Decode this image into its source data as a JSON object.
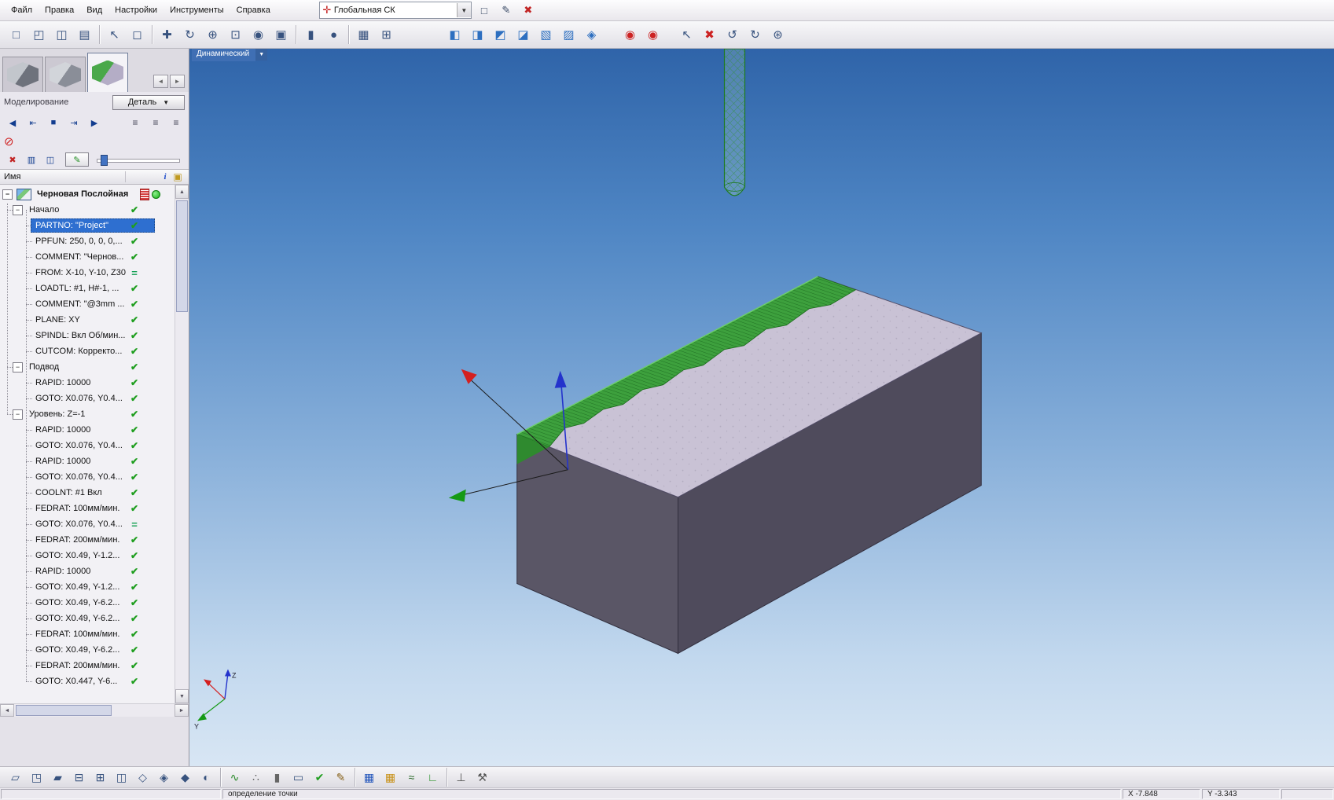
{
  "menubar": {
    "items": [
      "Файл",
      "Правка",
      "Вид",
      "Настройки",
      "Инструменты",
      "Справка"
    ],
    "csys_combo": {
      "value": "Глобальная СК",
      "icon": "✛"
    },
    "buttons": [
      {
        "name": "new-page",
        "glyph": "□"
      },
      {
        "name": "edit-postprocessor",
        "glyph": "✎"
      },
      {
        "name": "close-red",
        "glyph": "✖",
        "color": "#c22525"
      }
    ]
  },
  "toolbar_top": [
    {
      "name": "new-file",
      "glyph": "□"
    },
    {
      "name": "open-folder",
      "glyph": "◰"
    },
    {
      "name": "save-file",
      "glyph": "◫"
    },
    {
      "name": "print",
      "glyph": "▤"
    },
    {
      "sep": true
    },
    {
      "name": "select-arrow",
      "glyph": "↖"
    },
    {
      "name": "select-region",
      "glyph": "◻"
    },
    {
      "sep": true
    },
    {
      "name": "pan-view",
      "glyph": "✚"
    },
    {
      "name": "rotate-view",
      "glyph": "↻"
    },
    {
      "name": "zoom-view",
      "glyph": "⊕"
    },
    {
      "name": "zoom-window",
      "glyph": "⊡"
    },
    {
      "name": "camera-view",
      "glyph": "◉"
    },
    {
      "name": "snapshot",
      "glyph": "▣"
    },
    {
      "sep": true
    },
    {
      "name": "stock-cylinder",
      "glyph": "▮"
    },
    {
      "name": "stock-sphere",
      "glyph": "●"
    },
    {
      "sep": true
    },
    {
      "name": "data-table",
      "glyph": "▦"
    },
    {
      "name": "calculator",
      "glyph": "⊞"
    },
    {
      "space": 58
    },
    {
      "name": "view-filter-1",
      "glyph": "◧",
      "color": "#2d6fc0"
    },
    {
      "name": "view-filter-2",
      "glyph": "◨",
      "color": "#2d6fc0"
    },
    {
      "name": "view-filter-3",
      "glyph": "◩",
      "color": "#2d6fc0"
    },
    {
      "name": "view-filter-4",
      "glyph": "◪",
      "color": "#2d6fc0"
    },
    {
      "name": "view-filter-5",
      "glyph": "▧",
      "color": "#2d6fc0"
    },
    {
      "name": "view-filter-6",
      "glyph": "▨",
      "color": "#2d6fc0"
    },
    {
      "name": "view-filter-7",
      "glyph": "◈",
      "color": "#2d6fc0"
    },
    {
      "space": 20
    },
    {
      "name": "probe-point-1",
      "glyph": "◉",
      "color": "#cc2222"
    },
    {
      "name": "probe-point-2",
      "glyph": "◉",
      "color": "#cc2222"
    },
    {
      "space": 14
    },
    {
      "name": "cursor-erase",
      "glyph": "↖"
    },
    {
      "name": "delete-item",
      "glyph": "✖",
      "color": "#cc2222"
    },
    {
      "name": "rotate-ccw",
      "glyph": "↺"
    },
    {
      "name": "rotate-cw",
      "glyph": "↻"
    },
    {
      "name": "transform",
      "glyph": "⊛"
    }
  ],
  "left_panel": {
    "tabs": [
      {
        "name": "thumbnail-tab-1",
        "colors": [
          "#c2c6cc",
          "#6e727c"
        ]
      },
      {
        "name": "thumbnail-tab-2",
        "colors": [
          "#d2d5da",
          "#8a8e98"
        ]
      },
      {
        "name": "thumbnail-tab-3",
        "colors": [
          "#4aa84a",
          "#b4adc6"
        ]
      }
    ],
    "active_tab": 2,
    "tab_nav": [
      {
        "name": "tabs-scroll-left",
        "glyph": "◄"
      },
      {
        "name": "tabs-scroll-right",
        "glyph": "►"
      }
    ],
    "mode_label": "Моделирование",
    "detail_button": "Деталь",
    "playback": [
      {
        "name": "sim-step-back",
        "glyph": "◀"
      },
      {
        "name": "sim-to-begin",
        "glyph": "⇤"
      },
      {
        "name": "sim-stop",
        "glyph": "■"
      },
      {
        "name": "sim-to-end",
        "glyph": "⇥"
      },
      {
        "name": "sim-play",
        "glyph": "▶"
      }
    ],
    "trace_buttons": [
      {
        "name": "trace-list-1",
        "glyph": "≡"
      },
      {
        "name": "trace-list-2",
        "glyph": "≡"
      },
      {
        "name": "trace-list-3",
        "glyph": "≡"
      }
    ],
    "interrupt_glyph": "⊘",
    "edit_row": [
      {
        "name": "delete-trace",
        "glyph": "✖",
        "color": "#c22525"
      },
      {
        "name": "copy-trace",
        "glyph": "▥"
      },
      {
        "name": "save-trace",
        "glyph": "◫"
      }
    ],
    "pencil_glyph": "✎",
    "tree_header": {
      "name": "Имя",
      "info_glyph": "i",
      "folder_glyph": "▣"
    },
    "expander_glyph": "−",
    "check_glyph": "✔",
    "eq_glyph": "=",
    "tree": [
      {
        "label": "Черновая Послойная",
        "kind": "root",
        "status": "none",
        "extras": [
          "red-badge",
          "green-dot"
        ]
      },
      {
        "label": "Начало",
        "kind": "group",
        "status": "check"
      },
      {
        "label": "PARTNO: \"Project\"",
        "kind": "leaf",
        "status": "check",
        "selected": true
      },
      {
        "label": "PPFUN: 250, 0, 0, 0,...",
        "kind": "leaf",
        "status": "check"
      },
      {
        "label": "COMMENT: \"Чернов...",
        "kind": "leaf",
        "status": "check"
      },
      {
        "label": "FROM: X-10, Y-10, Z30",
        "kind": "leaf",
        "status": "eq"
      },
      {
        "label": "LOADTL: #1, H#-1, ...",
        "kind": "leaf",
        "status": "check"
      },
      {
        "label": "COMMENT: \"@3mm ...",
        "kind": "leaf",
        "status": "check"
      },
      {
        "label": "PLANE: XY",
        "kind": "leaf",
        "status": "check"
      },
      {
        "label": "SPINDL: Вкл Об/мин...",
        "kind": "leaf",
        "status": "check"
      },
      {
        "label": "CUTCOM: Корректо...",
        "kind": "leaf",
        "status": "check"
      },
      {
        "label": "Подвод",
        "kind": "group",
        "status": "check"
      },
      {
        "label": "RAPID: 10000",
        "kind": "leaf",
        "status": "check"
      },
      {
        "label": "GOTO: X0.076, Y0.4...",
        "kind": "leaf",
        "status": "check"
      },
      {
        "label": "Уровень: Z=-1",
        "kind": "group",
        "status": "check"
      },
      {
        "label": "RAPID: 10000",
        "kind": "leaf",
        "status": "check"
      },
      {
        "label": "GOTO: X0.076, Y0.4...",
        "kind": "leaf",
        "status": "check"
      },
      {
        "label": "RAPID: 10000",
        "kind": "leaf",
        "status": "check"
      },
      {
        "label": "GOTO: X0.076, Y0.4...",
        "kind": "leaf",
        "status": "check"
      },
      {
        "label": "COOLNT: #1 Вкл",
        "kind": "leaf",
        "status": "check"
      },
      {
        "label": "FEDRAT: 100мм/мин.",
        "kind": "leaf",
        "status": "check"
      },
      {
        "label": "GOTO: X0.076, Y0.4...",
        "kind": "leaf",
        "status": "eq"
      },
      {
        "label": "FEDRAT: 200мм/мин.",
        "kind": "leaf",
        "status": "check"
      },
      {
        "label": "GOTO: X0.49, Y-1.2...",
        "kind": "leaf",
        "status": "check"
      },
      {
        "label": "RAPID: 10000",
        "kind": "leaf",
        "status": "check"
      },
      {
        "label": "GOTO: X0.49, Y-1.2...",
        "kind": "leaf",
        "status": "check"
      },
      {
        "label": "GOTO: X0.49, Y-6.2...",
        "kind": "leaf",
        "status": "check"
      },
      {
        "label": "GOTO: X0.49, Y-6.2...",
        "kind": "leaf",
        "status": "check"
      },
      {
        "label": "FEDRAT: 100мм/мин.",
        "kind": "leaf",
        "status": "check"
      },
      {
        "label": "GOTO: X0.49, Y-6.2...",
        "kind": "leaf",
        "status": "check"
      },
      {
        "label": "FEDRAT: 200мм/мин.",
        "kind": "leaf",
        "status": "check"
      },
      {
        "label": "GOTO: X0.447, Y-6...",
        "kind": "leaf",
        "status": "check"
      }
    ]
  },
  "viewport": {
    "mode_combo": "Динамический",
    "axis_labels": {
      "z": "Z",
      "y": "Y"
    },
    "colors": {
      "top_face": "#c9c2d5",
      "left_face": "#5a5666",
      "right_face": "#4f4b5c",
      "machined_green": "#3da03d",
      "hatch_green": "#17621b",
      "tool_green": "#1d7a1f",
      "axis_red": "#d42020",
      "axis_green": "#159a15",
      "axis_blue": "#2433cc"
    }
  },
  "toolbar_bottom": [
    {
      "name": "stock-box",
      "glyph": "▱"
    },
    {
      "name": "stock-box-corner",
      "glyph": "◳"
    },
    {
      "name": "stock-box-fill",
      "glyph": "▰"
    },
    {
      "name": "stock-plane",
      "glyph": "⊟"
    },
    {
      "name": "stock-grid",
      "glyph": "⊞"
    },
    {
      "name": "stock-section",
      "glyph": "◫"
    },
    {
      "name": "view-cube-wire",
      "glyph": "◇"
    },
    {
      "name": "view-cube-half",
      "glyph": "◈"
    },
    {
      "name": "view-cube-solid",
      "glyph": "◆"
    },
    {
      "name": "view-cube-shade",
      "glyph": "◐"
    },
    {
      "sep": true
    },
    {
      "name": "spring-tool",
      "glyph": "∿",
      "color": "#2a8a2a"
    },
    {
      "name": "spheres-tool",
      "glyph": "∴",
      "color": "#555"
    },
    {
      "name": "cylinder-sphere-tool",
      "glyph": "▮",
      "color": "#666"
    },
    {
      "name": "stock-model-tool",
      "glyph": "▭"
    },
    {
      "name": "ok-check-tool",
      "glyph": "✔",
      "color": "#1f9e1f"
    },
    {
      "name": "edit-operation",
      "glyph": "✎",
      "color": "#88621a"
    },
    {
      "sep": true
    },
    {
      "name": "table-selected",
      "glyph": "▦",
      "color": "#2255bb"
    },
    {
      "name": "table-params",
      "glyph": "▦",
      "color": "#c8921a"
    },
    {
      "name": "toolpath-zigzag",
      "glyph": "≈",
      "color": "#2a6a2a"
    },
    {
      "name": "local-cs",
      "glyph": "∟",
      "color": "#1f8e1f"
    },
    {
      "sep": true
    },
    {
      "name": "mill-tool",
      "glyph": "⊥",
      "color": "#555"
    },
    {
      "name": "wrench-settings",
      "glyph": "⚒",
      "color": "#555"
    }
  ],
  "statusbar": {
    "message": "определение точки",
    "x": "X -7.848",
    "y": "Y -3.343"
  }
}
